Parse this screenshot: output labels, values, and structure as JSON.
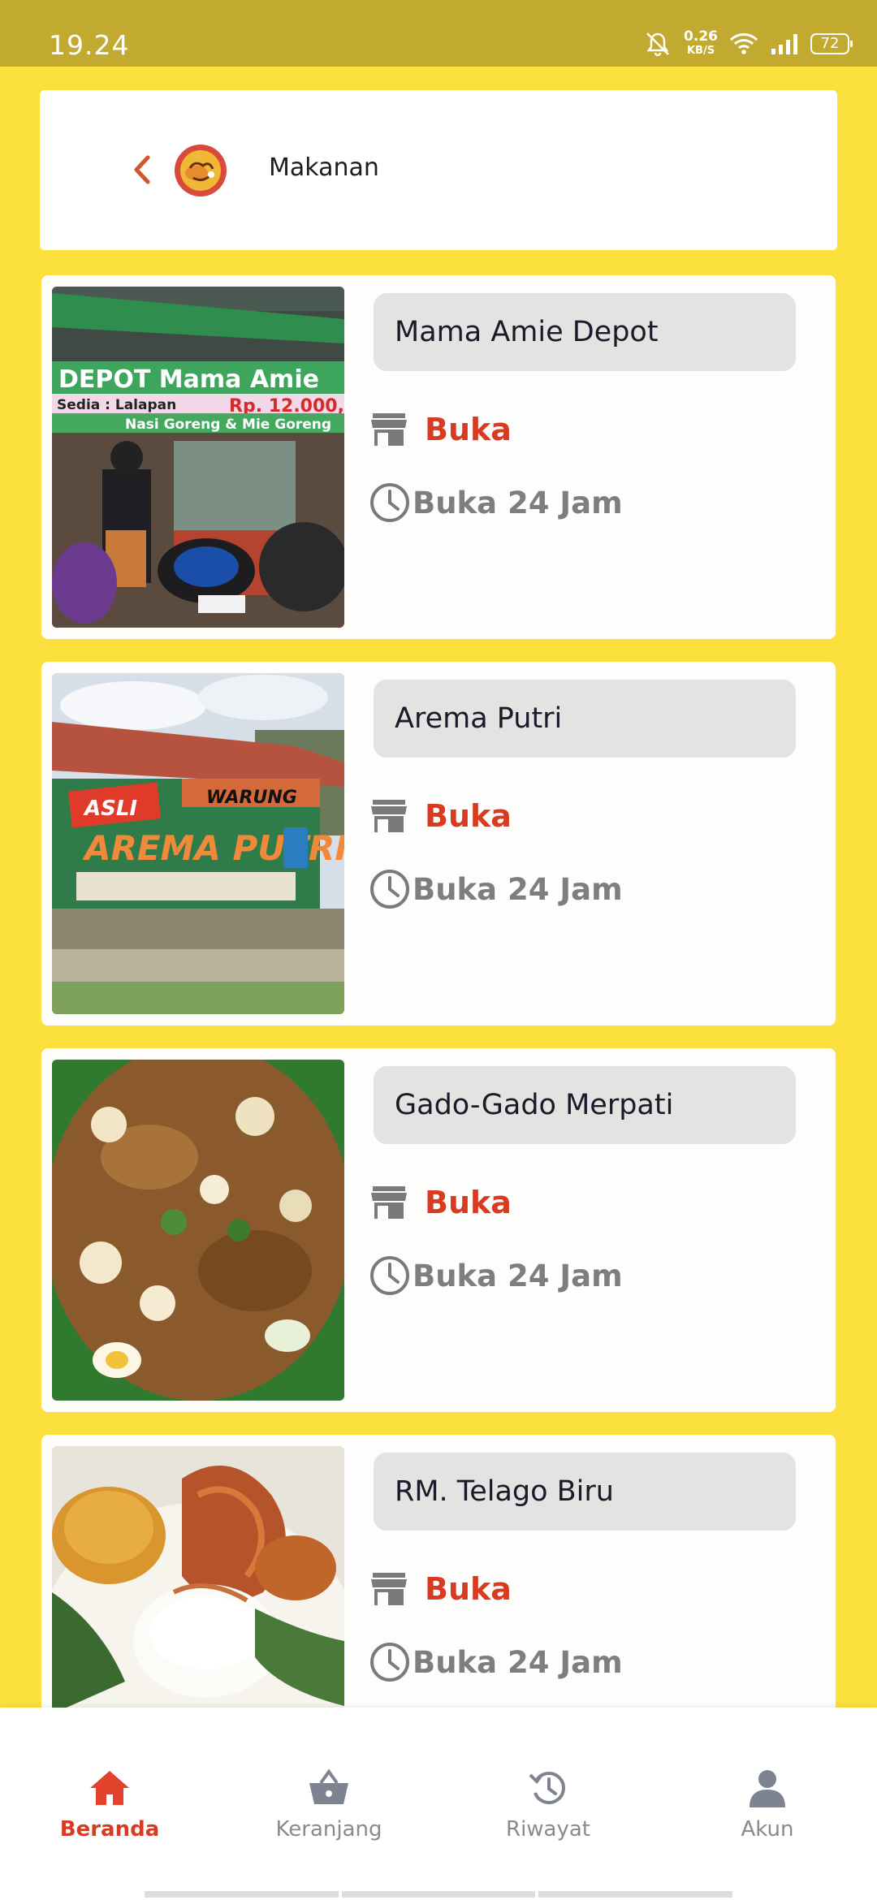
{
  "status_bar": {
    "time": "19.24",
    "net_speed": "0.26",
    "net_unit": "KB/S",
    "battery": "72"
  },
  "header": {
    "title": "Makanan",
    "back_icon": "chevron-left-icon",
    "logo_icon": "food-category-logo"
  },
  "restaurants": [
    {
      "name": "Mama Amie Depot",
      "status": "Buka",
      "hours": "Buka 24 Jam",
      "photo_sign_line1": "DEPOT Mama Amie",
      "photo_sign_line2": "Sedia : Lalapan",
      "photo_sign_price": "Rp. 12.000,-",
      "photo_sign_line3": "Nasi Goreng & Mie Goreng"
    },
    {
      "name": "Arema Putri",
      "status": "Buka",
      "hours": "Buka 24 Jam",
      "photo_sign_line1": "ASLI",
      "photo_sign_line2": "WARUNG",
      "photo_sign_line3": "AREMA PUTRI"
    },
    {
      "name": "Gado-Gado Merpati",
      "status": "Buka",
      "hours": "Buka 24 Jam"
    },
    {
      "name": "RM. Telago Biru",
      "status": "Buka",
      "hours": "Buka 24 Jam"
    }
  ],
  "bottom_nav": [
    {
      "label": "Beranda",
      "icon": "home-icon",
      "active": true
    },
    {
      "label": "Keranjang",
      "icon": "basket-icon",
      "active": false
    },
    {
      "label": "Riwayat",
      "icon": "history-icon",
      "active": false
    },
    {
      "label": "Akun",
      "icon": "user-icon",
      "active": false
    }
  ],
  "colors": {
    "background": "#fce03e",
    "status_bar": "#c2aa31",
    "accent": "#d83b21",
    "muted": "#7e7e7e"
  }
}
